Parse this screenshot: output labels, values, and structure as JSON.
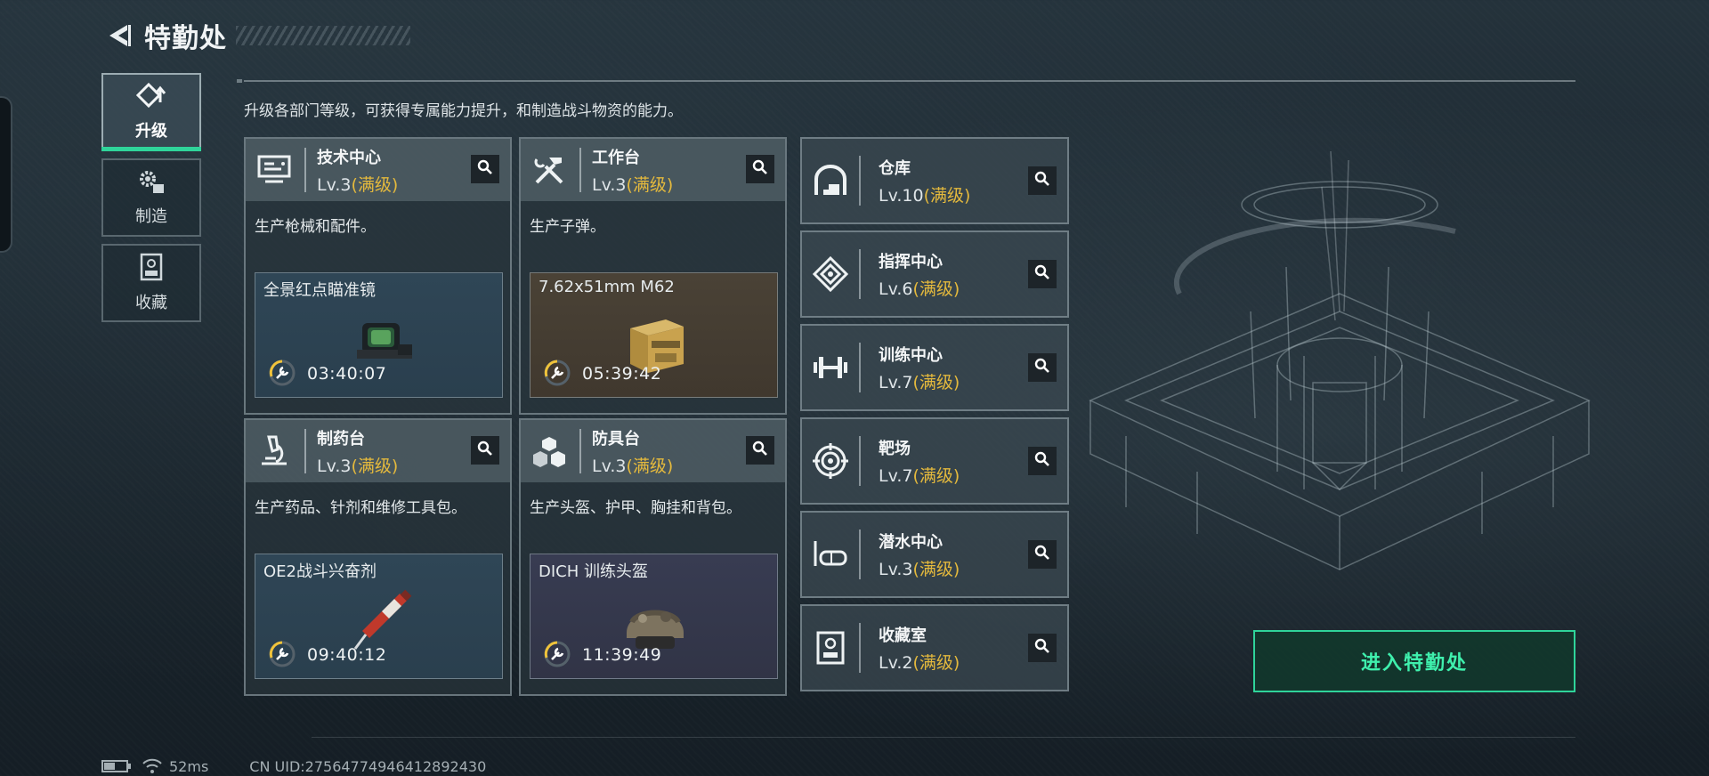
{
  "header": {
    "title": "特勤处"
  },
  "description": "升级各部门等级，可获得专属能力提升，和制造战斗物资的能力。",
  "nav": {
    "items": [
      {
        "label": "升级",
        "icon": "upgrade-icon",
        "active": true
      },
      {
        "label": "制造",
        "icon": "craft-gear-icon",
        "active": false
      },
      {
        "label": "收藏",
        "icon": "collection-icon",
        "active": false
      }
    ]
  },
  "stations": [
    {
      "name": "技术中心",
      "level": "Lv.3",
      "status": "(满级)",
      "icon": "tech-center-icon",
      "desc": "生产枪械和配件。",
      "production": {
        "item": "全景红点瞄准镜",
        "time": "03:40:07",
        "rarity_color": "#2f4656",
        "image": "red-dot-scope-image"
      }
    },
    {
      "name": "工作台",
      "level": "Lv.3",
      "status": "(满级)",
      "icon": "workbench-tools-icon",
      "desc": "生产子弹。",
      "production": {
        "item": "7.62x51mm M62",
        "time": "05:39:42",
        "rarity_color": "#4a4236",
        "image": "ammo-box-image"
      }
    },
    {
      "name": "制药台",
      "level": "Lv.3",
      "status": "(满级)",
      "icon": "microscope-icon",
      "desc": "生产药品、针剂和维修工具包。",
      "production": {
        "item": "OE2战斗兴奋剂",
        "time": "09:40:12",
        "rarity_color": "#2f4656",
        "image": "stimulant-injector-image"
      }
    },
    {
      "name": "防具台",
      "level": "Lv.3",
      "status": "(满级)",
      "icon": "armor-boxes-icon",
      "desc": "生产头盔、护甲、胸挂和背包。",
      "production": {
        "item": "DICH 训练头盔",
        "time": "11:39:49",
        "rarity_color": "#383c52",
        "image": "helmet-image"
      }
    }
  ],
  "facilities": [
    {
      "name": "仓库",
      "level": "Lv.10",
      "status": "(满级)",
      "icon": "warehouse-icon"
    },
    {
      "name": "指挥中心",
      "level": "Lv.6",
      "status": "(满级)",
      "icon": "command-center-icon"
    },
    {
      "name": "训练中心",
      "level": "Lv.7",
      "status": "(满级)",
      "icon": "dumbbell-icon"
    },
    {
      "name": "靶场",
      "level": "Lv.7",
      "status": "(满级)",
      "icon": "target-icon"
    },
    {
      "name": "潜水中心",
      "level": "Lv.3",
      "status": "(满级)",
      "icon": "diving-mask-icon"
    },
    {
      "name": "收藏室",
      "level": "Lv.2",
      "status": "(满级)",
      "icon": "collection-room-icon"
    }
  ],
  "enter_button": "进入特勤处",
  "status_bar": {
    "ping": "52ms",
    "uid": "CN UID:27564774946412892430"
  },
  "colors": {
    "accent_green": "#2fd49a",
    "max_level_gold": "#e4b93d"
  }
}
